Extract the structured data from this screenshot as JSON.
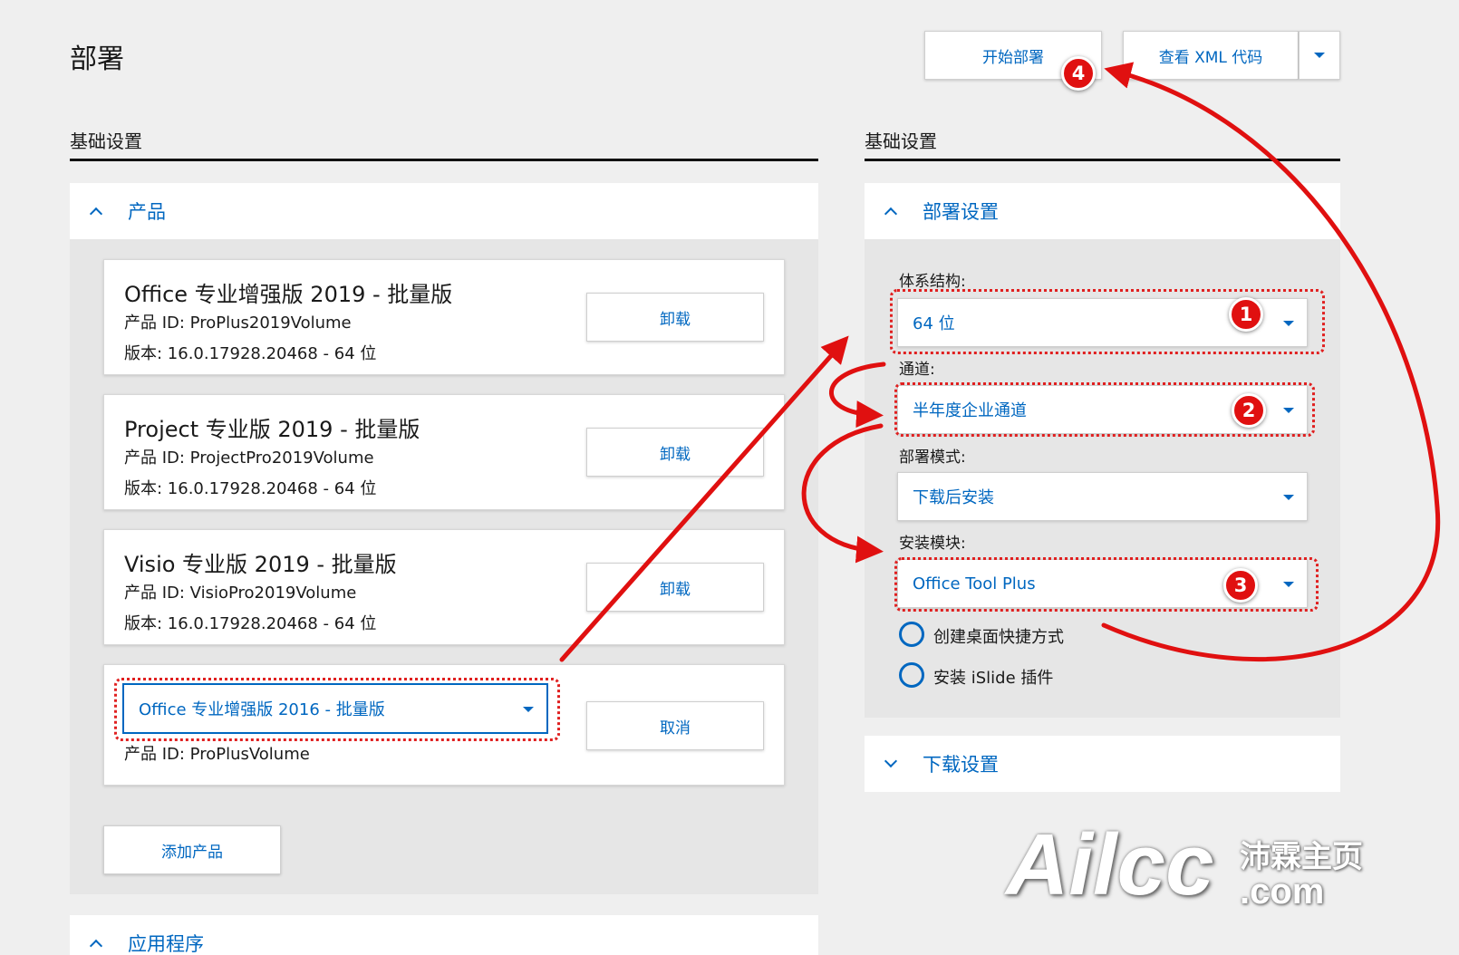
{
  "header": {
    "title": "部署",
    "start_button": "开始部署",
    "xml_button": "查看 XML 代码"
  },
  "left": {
    "section_title": "基础设置",
    "panel_title": "产品",
    "products": [
      {
        "name": "Office 专业增强版 2019 - 批量版",
        "id": "产品 ID: ProPlus2019Volume",
        "version": "版本: 16.0.17928.20468 - 64 位",
        "action": "卸载"
      },
      {
        "name": "Project 专业版 2019 - 批量版",
        "id": "产品 ID: ProjectPro2019Volume",
        "version": "版本: 16.0.17928.20468 - 64 位",
        "action": "卸载"
      },
      {
        "name": "Visio 专业版 2019 - 批量版",
        "id": "产品 ID: VisioPro2019Volume",
        "version": "版本: 16.0.17928.20468 - 64 位",
        "action": "卸载"
      }
    ],
    "new_product": {
      "selected": "Office 专业增强版 2016 - 批量版",
      "id": "产品 ID: ProPlusVolume",
      "action": "取消"
    },
    "add_button": "添加产品",
    "apps_panel_title": "应用程序"
  },
  "right": {
    "section_title": "基础设置",
    "panel_title": "部署设置",
    "fields": [
      {
        "label": "体系结构:",
        "value": "64 位"
      },
      {
        "label": "通道:",
        "value": "半年度企业通道"
      },
      {
        "label": "部署模式:",
        "value": "下载后安装"
      },
      {
        "label": "安装模块:",
        "value": "Office Tool Plus"
      }
    ],
    "options": [
      "创建桌面快捷方式",
      "安装 iSlide 插件"
    ],
    "download_panel_title": "下载设置"
  },
  "annotations": {
    "badges": [
      "1",
      "2",
      "3",
      "4"
    ],
    "color": "#e01010"
  },
  "watermark": {
    "brand": "Ailcc",
    "cn": "沛霖主页",
    "domain": ".com"
  },
  "colors": {
    "accent": "#0067c0",
    "background": "#efefef",
    "annotation": "#e01010"
  }
}
